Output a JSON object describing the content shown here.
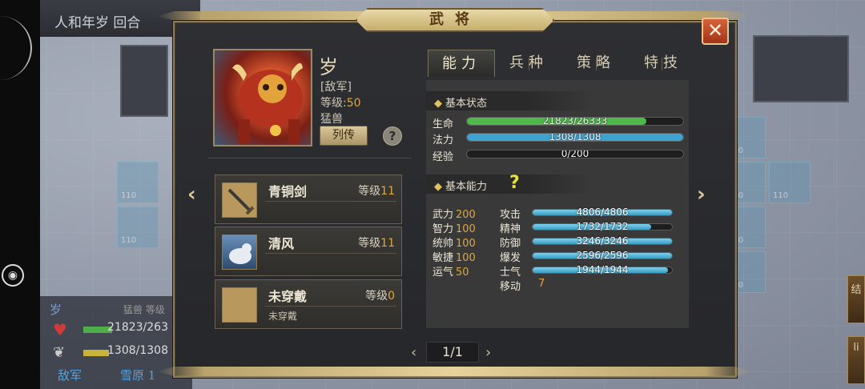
{
  "hud": {
    "top_title": "人和年岁 回合",
    "tile_label": "110",
    "unit_name": "岁",
    "unit_type": "猛兽 等级",
    "unit_hp": "21823/263",
    "unit_mp": "1308/1308",
    "unit_camp": "敌军",
    "unit_terrain": "雪原 1",
    "right_btn_1": "结",
    "right_btn_2": "li"
  },
  "dialog": {
    "title": "武将",
    "close_icon": "close-x-icon"
  },
  "general": {
    "name": "岁",
    "faction": "[敌军]",
    "level_label": "等级:",
    "level_value": "50",
    "class": "猛兽",
    "bio_button": "列传",
    "help": "?"
  },
  "equipment": [
    {
      "name": "青铜剑",
      "level_label": "等级",
      "level": "11",
      "sub": "",
      "icon": "bronze-sword-icon"
    },
    {
      "name": "清风",
      "level_label": "等级",
      "level": "11",
      "sub": "",
      "icon": "horse-icon"
    },
    {
      "name": "未穿戴",
      "level_label": "等级",
      "level": "0",
      "sub": "未穿戴",
      "icon": "empty-slot-icon"
    }
  ],
  "tabs": [
    {
      "label": "能力",
      "active": true
    },
    {
      "label": "兵种",
      "active": false
    },
    {
      "label": "策略",
      "active": false
    },
    {
      "label": "特技",
      "active": false
    }
  ],
  "basic_status": {
    "header": "基本状态",
    "rows": [
      {
        "label": "生命",
        "text": "21823/26333",
        "fraction": 0.8287,
        "color": "#4fb84a"
      },
      {
        "label": "法力",
        "text": "1308/1308",
        "fraction": 1.0,
        "color": "#3fa3d1"
      },
      {
        "label": "经验",
        "text": "0/200",
        "fraction": 0.0,
        "color": "#3fa3d1"
      }
    ]
  },
  "basic_ability": {
    "header": "基本能力",
    "help": "?",
    "attributes": [
      {
        "label": "武力",
        "value": "200"
      },
      {
        "label": "智力",
        "value": "100"
      },
      {
        "label": "统帅",
        "value": "100"
      },
      {
        "label": "敏捷",
        "value": "100"
      },
      {
        "label": "运气",
        "value": "50"
      }
    ],
    "stats": [
      {
        "label": "攻击",
        "text": "4806/4806",
        "fraction": 1.0
      },
      {
        "label": "精神",
        "text": "1732/1732",
        "fraction": 0.85
      },
      {
        "label": "防御",
        "text": "3246/3246",
        "fraction": 1.0
      },
      {
        "label": "爆发",
        "text": "2596/2596",
        "fraction": 1.0
      },
      {
        "label": "士气",
        "text": "1944/1944",
        "fraction": 0.97
      }
    ],
    "move_label": "移动",
    "move_value": "7"
  },
  "pager": {
    "prev": "‹",
    "current": "1/1",
    "next": "›"
  },
  "nav": {
    "prev_arrow": "‹",
    "next_arrow": "›"
  }
}
